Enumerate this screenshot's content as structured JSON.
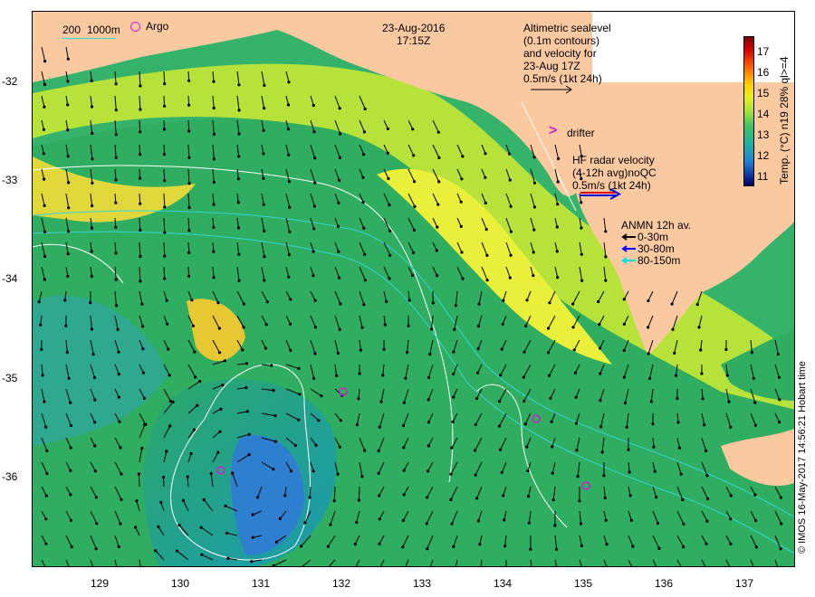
{
  "header": {
    "date": "23-Aug-2016",
    "time": "17:15Z"
  },
  "bathymetry_legend": {
    "label_200": "200",
    "label_1000": "1000m",
    "argo_label": "Argo"
  },
  "altimetry_legend": {
    "lines": [
      "Altimetric sealevel",
      "(0.1m contours)",
      "and velocity for",
      "23-Aug 17Z",
      "0.5m/s (1kt 24h)"
    ]
  },
  "drifter_legend": {
    "label": "drifter"
  },
  "hf_radar_legend": {
    "lines": [
      "HF radar velocity",
      "(4-12h avg)noQC",
      "0.5m/s (1kt 24h)"
    ]
  },
  "anmn_legend": {
    "title": "ANMN 12h av.",
    "items": [
      {
        "label": "0-30m",
        "color": "#000000"
      },
      {
        "label": "30-80m",
        "color": "#0000ff"
      },
      {
        "label": "80-150m",
        "color": "#00e0e0"
      }
    ]
  },
  "colorbar": {
    "label": "Temp. (°C) n19 28% ql>=4",
    "ticks": [
      "17",
      "16",
      "15",
      "14",
      "13",
      "12",
      "11"
    ],
    "min": 10.5,
    "max": 17.5
  },
  "credit": "© IMOS 16-May-2017 14:56:21 Hobart time",
  "axes": {
    "lat_ticks": [
      "-32",
      "-33",
      "-34",
      "-35",
      "-36"
    ],
    "lon_ticks": [
      "129",
      "130",
      "131",
      "132",
      "133",
      "134",
      "135",
      "136",
      "137"
    ]
  },
  "colors": {
    "land": "#fbc9a0",
    "argo": "#d020d0",
    "contour": "#ffffff",
    "isobath": "#33d6d6"
  }
}
